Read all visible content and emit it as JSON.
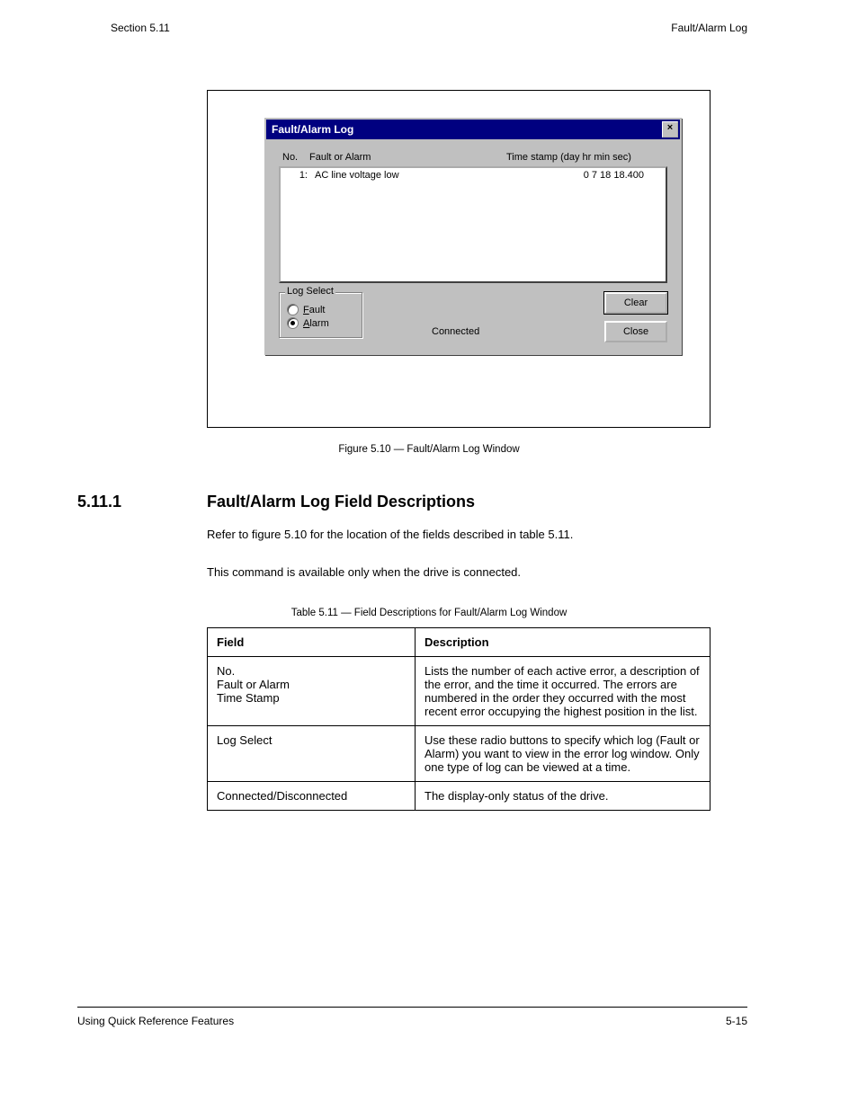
{
  "pageHeader": {
    "left": "Section 5.11",
    "right": "Fault/Alarm Log"
  },
  "dialog": {
    "title": "Fault/Alarm Log",
    "columns": {
      "no": "No.",
      "name": "Fault or Alarm",
      "ts": "Time stamp (day hr min sec)"
    },
    "entry": {
      "no": "1:",
      "name": "AC line voltage low",
      "ts": "0  7 18 18.400"
    },
    "group": {
      "legend": "Log Select",
      "opt1": "ault",
      "opt1u": "F",
      "opt2": "larm",
      "opt2u": "A",
      "selected": "alarm"
    },
    "status": "Connected",
    "buttons": {
      "clear": "Clear",
      "close": "Close"
    }
  },
  "figCaption": "Figure 5.10 — Fault/Alarm Log Window",
  "section": {
    "label": "5.11.1",
    "title": "Fault/Alarm Log Field Descriptions"
  },
  "para1": "Refer to figure 5.10 for the location of the fields described in table 5.11.",
  "para2": "This command is available only when the drive is connected.",
  "tblCaption": "Table 5.11 — Field Descriptions for Fault/Alarm Log Window",
  "table": {
    "headers": {
      "c0": "Field",
      "c1": "Description"
    },
    "rows": [
      {
        "c0": "No.\nFault or Alarm\nTime Stamp",
        "c1": "Lists the number of each active error, a description of the error, and the time it occurred. The errors are numbered in the order they occurred with the most recent error occupying the highest position in the list."
      },
      {
        "c0": "Log Select",
        "c1": "Use these radio buttons to specify which log (Fault or Alarm) you want to view in the error log window. Only one type of log can be viewed at a time."
      },
      {
        "c0": "Connected/Disconnected",
        "c1": "The display-only status of the drive."
      }
    ]
  },
  "footer": {
    "left": "Using Quick Reference Features",
    "right": "5-15"
  }
}
